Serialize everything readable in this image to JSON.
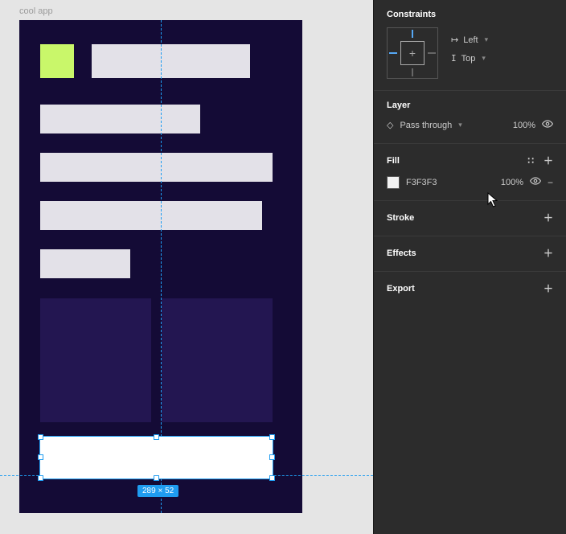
{
  "frame": {
    "label": "cool app"
  },
  "selection": {
    "dim_label": "289 × 52"
  },
  "panel": {
    "constraints": {
      "title": "Constraints",
      "h_label": "Left",
      "v_label": "Top"
    },
    "layer": {
      "title": "Layer",
      "blend_mode": "Pass through",
      "opacity": "100%"
    },
    "fill": {
      "title": "Fill",
      "hex": "F3F3F3",
      "opacity": "100%",
      "swatch_color": "#f3f3f3"
    },
    "stroke": {
      "title": "Stroke"
    },
    "effects": {
      "title": "Effects"
    },
    "export": {
      "title": "Export"
    }
  }
}
